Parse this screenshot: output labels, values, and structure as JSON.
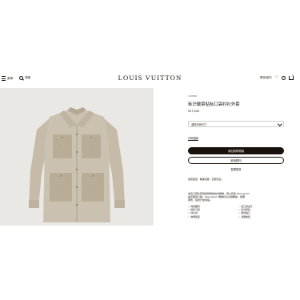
{
  "header": {
    "menu_label": "菜单",
    "search_label": "搜索",
    "logo": "LOUIS VUITTON",
    "contact_label": "联系我们",
    "bag_count": "1"
  },
  "product": {
    "ref": "1A8IBD",
    "title": "标识徽章贴标口袋衬衫外套",
    "price": "¥17,400",
    "size_placeholder": "选择尺码尺寸",
    "size_guide": "尺码指南",
    "add_to_cart": "添加到购物袋",
    "contact_advisor": "致电顾问",
    "more_label": "查看更多",
    "delivery_note": "免费配送 · 精美包装 · 直营售后"
  },
  "description": {
    "lines": [
      "本款工装外套选用棉质斜纹布裁制，饰以同色 Monogram",
      "提花图案口袋，Monogram 徽章标识点缀胸前，经典",
      "廓形，适合日常叠搭。"
    ],
    "features": [
      "棉质面料",
      "四口袋设计",
      "按扣门襟",
      "标识纽扣",
      "衬衫领",
      "纽扣袖口",
      "常规版型",
      "法国制造"
    ]
  },
  "colors": {
    "accent": "#19110b",
    "gallery_bg": "#eae8e4",
    "jacket": "#c9bfae",
    "jacket_dark": "#a59a89",
    "border": "#cfcfcf"
  }
}
